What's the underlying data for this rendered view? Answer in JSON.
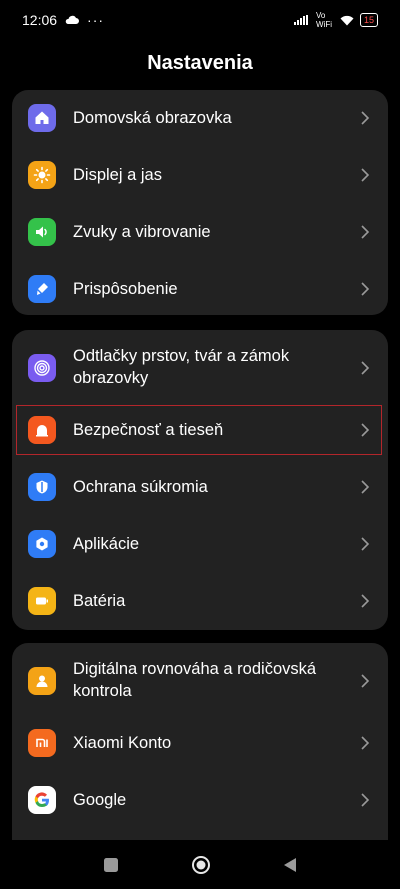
{
  "status": {
    "time": "12:06",
    "network": "Vo WiFi",
    "battery": "15"
  },
  "header": {
    "title": "Nastavenia"
  },
  "groups": [
    {
      "items": [
        {
          "label": "Domovská obrazovka",
          "icon": "home-icon",
          "color": "#6e6bea"
        },
        {
          "label": "Displej a jas",
          "icon": "sun-icon",
          "color": "#f4a316"
        },
        {
          "label": "Zvuky a vibrovanie",
          "icon": "speaker-icon",
          "color": "#34c24a"
        },
        {
          "label": "Prispôsobenie",
          "icon": "brush-icon",
          "color": "#2f7cf6"
        }
      ]
    },
    {
      "items": [
        {
          "label": "Odtlačky prstov, tvár a zámok obrazovky",
          "icon": "fingerprint-icon",
          "color": "#7a5cf0"
        },
        {
          "label": "Bezpečnosť a tieseň",
          "icon": "sos-icon",
          "color": "#f4581f",
          "highlighted": true
        },
        {
          "label": "Ochrana súkromia",
          "icon": "privacy-icon",
          "color": "#2f7cf6"
        },
        {
          "label": "Aplikácie",
          "icon": "apps-icon",
          "color": "#2f7cf6"
        },
        {
          "label": "Batéria",
          "icon": "battery-icon",
          "color": "#f4b416"
        }
      ]
    },
    {
      "items": [
        {
          "label": "Digitálna rovnováha a rodičovská kontrola",
          "icon": "person-icon",
          "color": "#f4a316"
        },
        {
          "label": "Xiaomi Konto",
          "icon": "mi-icon",
          "color": "#f46a1f"
        },
        {
          "label": "Google",
          "icon": "google-icon",
          "color": "#ffffff"
        }
      ]
    }
  ]
}
